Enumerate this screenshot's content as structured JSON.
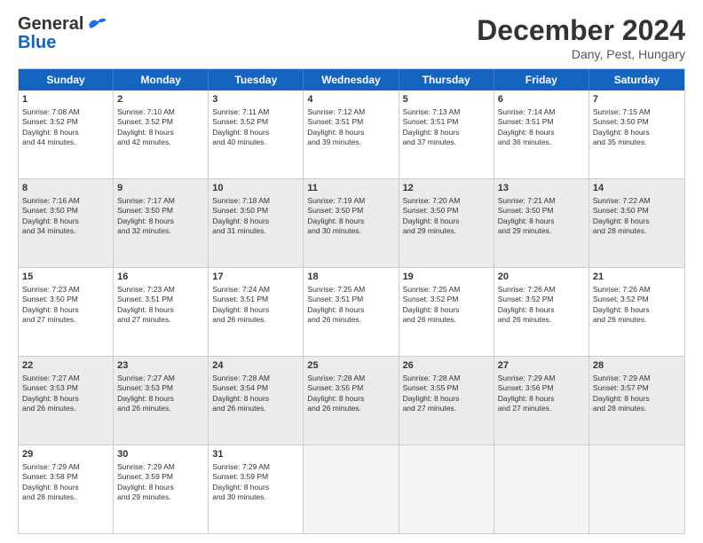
{
  "logo": {
    "line1": "General",
    "line2": "Blue",
    "bird_color": "#1a73e8"
  },
  "title": "December 2024",
  "subtitle": "Dany, Pest, Hungary",
  "days": [
    "Sunday",
    "Monday",
    "Tuesday",
    "Wednesday",
    "Thursday",
    "Friday",
    "Saturday"
  ],
  "weeks": [
    [
      {
        "day": "1",
        "info": "Sunrise: 7:08 AM\nSunset: 3:52 PM\nDaylight: 8 hours\nand 44 minutes.",
        "shade": false
      },
      {
        "day": "2",
        "info": "Sunrise: 7:10 AM\nSunset: 3:52 PM\nDaylight: 8 hours\nand 42 minutes.",
        "shade": false
      },
      {
        "day": "3",
        "info": "Sunrise: 7:11 AM\nSunset: 3:52 PM\nDaylight: 8 hours\nand 40 minutes.",
        "shade": false
      },
      {
        "day": "4",
        "info": "Sunrise: 7:12 AM\nSunset: 3:51 PM\nDaylight: 8 hours\nand 39 minutes.",
        "shade": false
      },
      {
        "day": "5",
        "info": "Sunrise: 7:13 AM\nSunset: 3:51 PM\nDaylight: 8 hours\nand 37 minutes.",
        "shade": false
      },
      {
        "day": "6",
        "info": "Sunrise: 7:14 AM\nSunset: 3:51 PM\nDaylight: 8 hours\nand 36 minutes.",
        "shade": false
      },
      {
        "day": "7",
        "info": "Sunrise: 7:15 AM\nSunset: 3:50 PM\nDaylight: 8 hours\nand 35 minutes.",
        "shade": false
      }
    ],
    [
      {
        "day": "8",
        "info": "Sunrise: 7:16 AM\nSunset: 3:50 PM\nDaylight: 8 hours\nand 34 minutes.",
        "shade": true
      },
      {
        "day": "9",
        "info": "Sunrise: 7:17 AM\nSunset: 3:50 PM\nDaylight: 8 hours\nand 32 minutes.",
        "shade": true
      },
      {
        "day": "10",
        "info": "Sunrise: 7:18 AM\nSunset: 3:50 PM\nDaylight: 8 hours\nand 31 minutes.",
        "shade": true
      },
      {
        "day": "11",
        "info": "Sunrise: 7:19 AM\nSunset: 3:50 PM\nDaylight: 8 hours\nand 30 minutes.",
        "shade": true
      },
      {
        "day": "12",
        "info": "Sunrise: 7:20 AM\nSunset: 3:50 PM\nDaylight: 8 hours\nand 29 minutes.",
        "shade": true
      },
      {
        "day": "13",
        "info": "Sunrise: 7:21 AM\nSunset: 3:50 PM\nDaylight: 8 hours\nand 29 minutes.",
        "shade": true
      },
      {
        "day": "14",
        "info": "Sunrise: 7:22 AM\nSunset: 3:50 PM\nDaylight: 8 hours\nand 28 minutes.",
        "shade": true
      }
    ],
    [
      {
        "day": "15",
        "info": "Sunrise: 7:23 AM\nSunset: 3:50 PM\nDaylight: 8 hours\nand 27 minutes.",
        "shade": false
      },
      {
        "day": "16",
        "info": "Sunrise: 7:23 AM\nSunset: 3:51 PM\nDaylight: 8 hours\nand 27 minutes.",
        "shade": false
      },
      {
        "day": "17",
        "info": "Sunrise: 7:24 AM\nSunset: 3:51 PM\nDaylight: 8 hours\nand 26 minutes.",
        "shade": false
      },
      {
        "day": "18",
        "info": "Sunrise: 7:25 AM\nSunset: 3:51 PM\nDaylight: 8 hours\nand 26 minutes.",
        "shade": false
      },
      {
        "day": "19",
        "info": "Sunrise: 7:25 AM\nSunset: 3:52 PM\nDaylight: 8 hours\nand 26 minutes.",
        "shade": false
      },
      {
        "day": "20",
        "info": "Sunrise: 7:26 AM\nSunset: 3:52 PM\nDaylight: 8 hours\nand 26 minutes.",
        "shade": false
      },
      {
        "day": "21",
        "info": "Sunrise: 7:26 AM\nSunset: 3:52 PM\nDaylight: 8 hours\nand 26 minutes.",
        "shade": false
      }
    ],
    [
      {
        "day": "22",
        "info": "Sunrise: 7:27 AM\nSunset: 3:53 PM\nDaylight: 8 hours\nand 26 minutes.",
        "shade": true
      },
      {
        "day": "23",
        "info": "Sunrise: 7:27 AM\nSunset: 3:53 PM\nDaylight: 8 hours\nand 26 minutes.",
        "shade": true
      },
      {
        "day": "24",
        "info": "Sunrise: 7:28 AM\nSunset: 3:54 PM\nDaylight: 8 hours\nand 26 minutes.",
        "shade": true
      },
      {
        "day": "25",
        "info": "Sunrise: 7:28 AM\nSunset: 3:55 PM\nDaylight: 8 hours\nand 26 minutes.",
        "shade": true
      },
      {
        "day": "26",
        "info": "Sunrise: 7:28 AM\nSunset: 3:55 PM\nDaylight: 8 hours\nand 27 minutes.",
        "shade": true
      },
      {
        "day": "27",
        "info": "Sunrise: 7:29 AM\nSunset: 3:56 PM\nDaylight: 8 hours\nand 27 minutes.",
        "shade": true
      },
      {
        "day": "28",
        "info": "Sunrise: 7:29 AM\nSunset: 3:57 PM\nDaylight: 8 hours\nand 28 minutes.",
        "shade": true
      }
    ],
    [
      {
        "day": "29",
        "info": "Sunrise: 7:29 AM\nSunset: 3:58 PM\nDaylight: 8 hours\nand 28 minutes.",
        "shade": false
      },
      {
        "day": "30",
        "info": "Sunrise: 7:29 AM\nSunset: 3:59 PM\nDaylight: 8 hours\nand 29 minutes.",
        "shade": false
      },
      {
        "day": "31",
        "info": "Sunrise: 7:29 AM\nSunset: 3:59 PM\nDaylight: 8 hours\nand 30 minutes.",
        "shade": false
      },
      {
        "day": "",
        "info": "",
        "shade": false,
        "empty": true
      },
      {
        "day": "",
        "info": "",
        "shade": false,
        "empty": true
      },
      {
        "day": "",
        "info": "",
        "shade": false,
        "empty": true
      },
      {
        "day": "",
        "info": "",
        "shade": false,
        "empty": true
      }
    ]
  ]
}
